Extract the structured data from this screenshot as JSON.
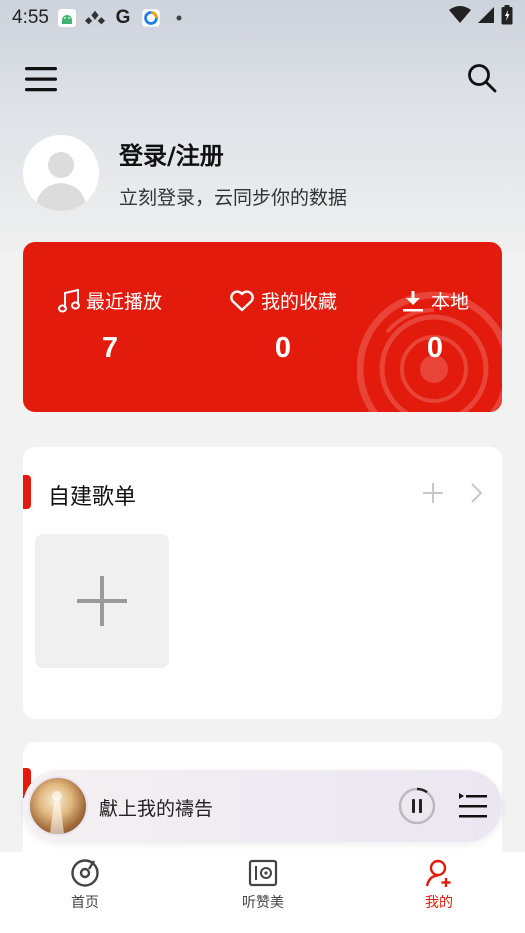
{
  "colors": {
    "accent": "#e31b0c",
    "background": "#f2f2f2",
    "card": "#ffffff"
  },
  "status_bar": {
    "time": "4:55",
    "notification_icons": [
      "android-robot-icon",
      "diamond-app-icon",
      "google-icon",
      "browser-icon",
      "dot-icon"
    ],
    "system_icons": [
      "wifi-icon",
      "signal-icon",
      "battery-icon"
    ]
  },
  "header": {
    "menu_icon": "hamburger-menu-icon",
    "search_icon": "search-icon"
  },
  "profile": {
    "avatar_icon": "default-user-avatar-icon",
    "title": "登录/注册",
    "subtitle": "立刻登录，云同步你的数据"
  },
  "stats": [
    {
      "icon": "music-note-icon",
      "label": "最近播放",
      "value": "7"
    },
    {
      "icon": "heart-icon",
      "label": "我的收藏",
      "value": "0"
    },
    {
      "icon": "download-icon",
      "label": "本地",
      "value": "0"
    }
  ],
  "playlists": {
    "title": "自建歌单",
    "add_icon": "plus-icon",
    "more_icon": "chevron-right-icon",
    "create_tile_icon": "plus-icon"
  },
  "now_playing": {
    "title": "獻上我的禱告",
    "state": "playing",
    "pause_icon": "pause-icon",
    "queue_icon": "playlist-queue-icon"
  },
  "bottom_nav": [
    {
      "icon": "disc-icon",
      "label": "首页",
      "active": false
    },
    {
      "icon": "player-icon",
      "label": "听赞美",
      "active": false
    },
    {
      "icon": "user-add-icon",
      "label": "我的",
      "active": true
    }
  ]
}
